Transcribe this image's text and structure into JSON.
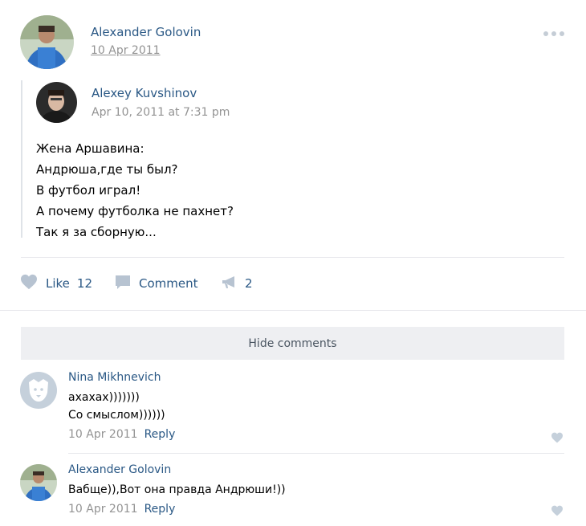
{
  "post": {
    "author_name": "Alexander Golovin",
    "date": "10 Apr 2011",
    "repost": {
      "author_name": "Alexey Kuvshinov",
      "date": "Apr 10, 2011 at 7:31 pm",
      "text_lines": [
        "Жена Аршавина:",
        "Андрюша,где ты был?",
        "В футбол играл!",
        "А почему футболка не пахнет?",
        "Так я за сборную..."
      ]
    },
    "actions": {
      "like_label": "Like",
      "like_count": "12",
      "comment_label": "Comment",
      "share_count": "2"
    }
  },
  "comments_section": {
    "hide_label": "Hide comments",
    "comments": [
      {
        "author_name": "Nina Mikhnevich",
        "lines": [
          "ахахах)))))))",
          "Со смыслом))))))"
        ],
        "date": "10 Apr 2011",
        "reply_label": "Reply"
      },
      {
        "author_name": "Alexander Golovin",
        "lines": [
          "Вабще)),Вот она правда Андрюши!))"
        ],
        "date": "10 Apr 2011",
        "reply_label": "Reply"
      }
    ]
  },
  "icons": {
    "like": "heart-icon",
    "comment": "comment-icon",
    "share": "megaphone-icon",
    "more": "more-dots-icon",
    "default_avatar": "dog-avatar-icon"
  },
  "colors": {
    "link": "#2a5885",
    "muted": "#939393",
    "icon": "#b7c3d1",
    "hide_bg": "#eeeff2"
  }
}
